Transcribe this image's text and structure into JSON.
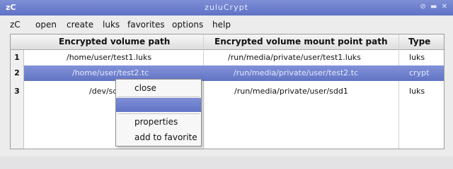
{
  "window": {
    "app_icon": "zC",
    "title": "zuluCrypt",
    "buttons": [
      "⊘",
      "▬",
      "✕"
    ]
  },
  "menu": {
    "items": [
      "zC",
      "open",
      "create",
      "luks",
      "favorites",
      "options",
      "help"
    ]
  },
  "table": {
    "columns": [
      "Encrypted volume path",
      "Encrypted volume mount point path",
      "Type"
    ],
    "row_numbers": [
      "1",
      "2",
      "3"
    ],
    "rows": [
      {
        "path": "/home/user/test1.luks",
        "mount": "/run/media/private/user/test1.luks",
        "type": "luks",
        "selected": false
      },
      {
        "path": "/home/user/test2.tc",
        "mount": "/run/media/private/user/test2.tc",
        "type": "crypt",
        "selected": true
      },
      {
        "path": "/dev/sdd1",
        "mount": "/run/media/private/user/sdd1",
        "type": "luks",
        "selected": false
      }
    ]
  },
  "context_menu": {
    "items": [
      "close",
      "",
      "properties",
      "add to favorite"
    ],
    "highlighted_index": 1
  },
  "colors": {
    "selection": "#6b7cc9",
    "titlebar": "#6f80cd"
  }
}
